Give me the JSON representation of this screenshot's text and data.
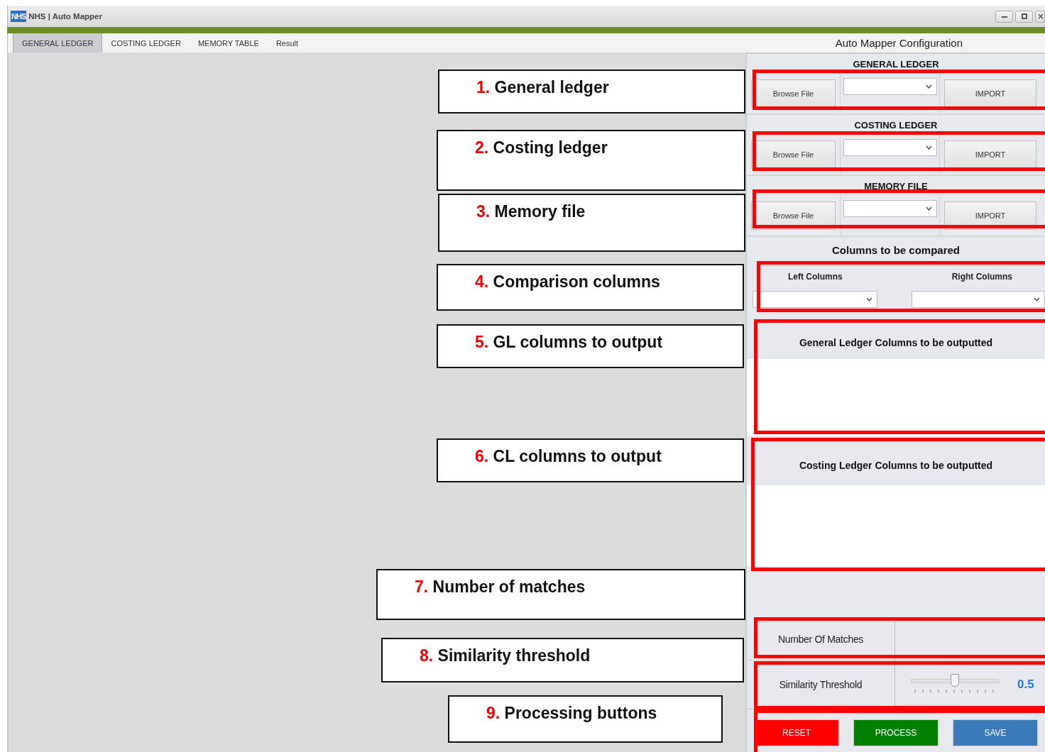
{
  "window": {
    "logo": "NHS",
    "title": "NHS | Auto Mapper"
  },
  "tabs": [
    {
      "label": "GENERAL LEDGER",
      "selected": true
    },
    {
      "label": "COSTING LEDGER",
      "selected": false
    },
    {
      "label": "MEMORY TABLE",
      "selected": false
    },
    {
      "label": "Result",
      "selected": false
    }
  ],
  "config": {
    "title": "Auto Mapper Configuration",
    "file_sections": [
      {
        "heading": "GENERAL LEDGER",
        "browse_button": "Browse File",
        "import_button": "IMPORT"
      },
      {
        "heading": "COSTING LEDGER",
        "browse_button": "Browse File",
        "import_button": "IMPORT"
      },
      {
        "heading": "MEMORY FILE",
        "browse_button": "Browse File",
        "import_button": "IMPORT"
      }
    ],
    "comparison": {
      "heading": "Columns to be compared",
      "left_label": "Left Columns",
      "right_label": "Right Columns"
    },
    "output_lists": [
      {
        "heading": "General Ledger Columns to be outputted"
      },
      {
        "heading": "Costing Ledger Columns to be outputted"
      }
    ],
    "number_of_matches": {
      "label": "Number Of Matches"
    },
    "similarity_threshold": {
      "label": "Similarity Threshold",
      "level": 0.5,
      "reading": "0.5"
    },
    "buttons": [
      {
        "label": "RESET",
        "kind": "reset"
      },
      {
        "label": "PROCESS",
        "kind": "process"
      },
      {
        "label": "SAVE",
        "kind": "save"
      }
    ]
  },
  "callouts": [
    {
      "number": "1.",
      "text": "General ledger"
    },
    {
      "number": "2.",
      "text": "Costing ledger"
    },
    {
      "number": "3.",
      "text": "Memory file"
    },
    {
      "number": "4.",
      "text": "Comparison columns"
    },
    {
      "number": "5.",
      "text": "GL columns to output"
    },
    {
      "number": "6.",
      "text": "CL columns to output"
    },
    {
      "number": "7.",
      "text": "Number of matches"
    },
    {
      "number": "8.",
      "text": "Similarity threshold"
    },
    {
      "number": "9.",
      "text": "Processing buttons"
    }
  ]
}
